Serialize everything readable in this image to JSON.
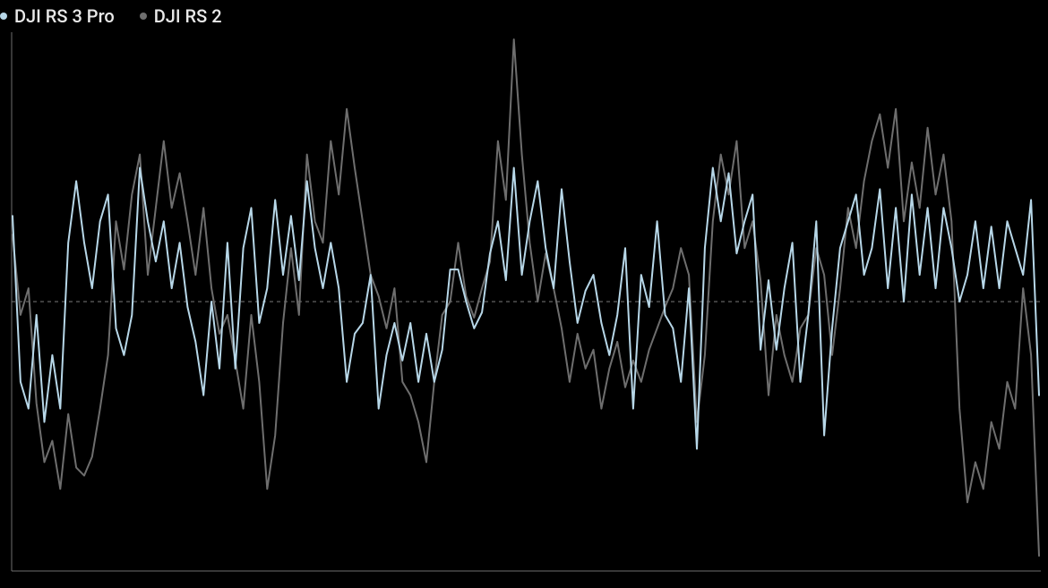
{
  "legend": {
    "items": [
      {
        "label": "DJI RS 3 Pro",
        "color": "#b7d7e8"
      },
      {
        "label": "DJI RS 2",
        "color": "#6e6e6e"
      }
    ]
  },
  "chart_data": {
    "type": "line",
    "title": "",
    "xlabel": "",
    "ylabel": "",
    "ylim": [
      -1,
      1
    ],
    "grid": false,
    "midline": 0,
    "legend_position": "top-left",
    "x": [
      0,
      1,
      2,
      3,
      4,
      5,
      6,
      7,
      8,
      9,
      10,
      11,
      12,
      13,
      14,
      15,
      16,
      17,
      18,
      19,
      20,
      21,
      22,
      23,
      24,
      25,
      26,
      27,
      28,
      29,
      30,
      31,
      32,
      33,
      34,
      35,
      36,
      37,
      38,
      39,
      40,
      41,
      42,
      43,
      44,
      45,
      46,
      47,
      48,
      49,
      50,
      51,
      52,
      53,
      54,
      55,
      56,
      57,
      58,
      59,
      60,
      61,
      62,
      63,
      64,
      65,
      66,
      67,
      68,
      69,
      70,
      71,
      72,
      73,
      74,
      75,
      76,
      77,
      78,
      79,
      80,
      81,
      82,
      83,
      84,
      85,
      86,
      87,
      88,
      89,
      90,
      91,
      92,
      93,
      94,
      95,
      96,
      97,
      98,
      99,
      100,
      101,
      102,
      103,
      104,
      105,
      106,
      107,
      108,
      109,
      110,
      111,
      112,
      113,
      114,
      115,
      116,
      117,
      118,
      119,
      120,
      121,
      122,
      123,
      124,
      125,
      126,
      127,
      128,
      129
    ],
    "series": [
      {
        "name": "DJI RS 3 Pro",
        "color": "#b7d7e8",
        "values": [
          0.32,
          -0.3,
          -0.4,
          -0.05,
          -0.45,
          -0.2,
          -0.4,
          0.22,
          0.45,
          0.22,
          0.05,
          0.3,
          0.4,
          -0.1,
          -0.2,
          -0.05,
          0.5,
          0.3,
          0.15,
          0.3,
          0.05,
          0.22,
          -0.02,
          -0.15,
          -0.35,
          0.0,
          -0.25,
          0.22,
          -0.25,
          0.2,
          0.35,
          -0.08,
          0.05,
          0.38,
          0.1,
          0.32,
          0.08,
          0.45,
          0.2,
          0.05,
          0.22,
          0.05,
          -0.3,
          -0.12,
          -0.08,
          0.1,
          -0.4,
          -0.2,
          -0.08,
          -0.22,
          -0.08,
          -0.3,
          -0.12,
          -0.3,
          -0.18,
          0.12,
          0.12,
          0.0,
          -0.1,
          -0.04,
          0.18,
          0.3,
          0.08,
          0.5,
          0.1,
          0.3,
          0.45,
          0.2,
          0.05,
          0.42,
          0.15,
          -0.08,
          0.04,
          0.1,
          -0.08,
          -0.2,
          -0.05,
          0.2,
          -0.4,
          0.1,
          -0.02,
          0.3,
          -0.05,
          -0.1,
          -0.3,
          0.05,
          -0.55,
          0.2,
          0.5,
          0.3,
          0.48,
          0.18,
          0.3,
          0.4,
          -0.18,
          0.08,
          -0.18,
          0.05,
          0.22,
          -0.3,
          -0.05,
          0.3,
          -0.5,
          -0.1,
          0.2,
          0.3,
          0.4,
          0.1,
          0.2,
          0.42,
          0.05,
          0.35,
          0.0,
          0.4,
          0.1,
          0.35,
          0.05,
          0.35,
          0.2,
          0.0,
          0.1,
          0.3,
          0.05,
          0.28,
          0.05,
          0.3,
          0.2,
          0.1,
          0.38,
          -0.35
        ]
      },
      {
        "name": "DJI RS 2",
        "color": "#6e6e6e",
        "values": [
          0.25,
          -0.05,
          0.05,
          -0.38,
          -0.6,
          -0.52,
          -0.7,
          -0.42,
          -0.62,
          -0.65,
          -0.58,
          -0.4,
          -0.2,
          0.3,
          0.12,
          0.4,
          0.55,
          0.1,
          0.35,
          0.6,
          0.35,
          0.48,
          0.3,
          0.1,
          0.35,
          0.05,
          -0.12,
          -0.05,
          -0.22,
          -0.4,
          -0.05,
          -0.3,
          -0.7,
          -0.5,
          -0.08,
          0.2,
          -0.05,
          0.55,
          0.3,
          0.22,
          0.6,
          0.4,
          0.72,
          0.5,
          0.3,
          0.1,
          0.02,
          -0.1,
          0.05,
          -0.3,
          -0.35,
          -0.45,
          -0.6,
          -0.3,
          -0.05,
          0.0,
          0.22,
          0.02,
          -0.06,
          0.05,
          0.15,
          0.6,
          0.38,
          0.98,
          0.55,
          0.22,
          0.0,
          0.18,
          0.05,
          -0.1,
          -0.3,
          -0.12,
          -0.25,
          -0.18,
          -0.4,
          -0.25,
          -0.15,
          -0.32,
          -0.22,
          -0.3,
          -0.18,
          -0.1,
          -0.02,
          0.05,
          0.2,
          0.1,
          -0.45,
          -0.2,
          0.3,
          0.55,
          0.4,
          0.6,
          0.2,
          0.3,
          0.08,
          -0.35,
          -0.05,
          -0.2,
          -0.3,
          -0.1,
          -0.05,
          0.2,
          0.1,
          -0.2,
          0.05,
          0.35,
          0.2,
          0.45,
          0.6,
          0.7,
          0.5,
          0.72,
          0.3,
          0.52,
          0.35,
          0.65,
          0.4,
          0.55,
          0.3,
          -0.4,
          -0.75,
          -0.6,
          -0.7,
          -0.45,
          -0.55,
          -0.3,
          -0.4,
          0.05,
          -0.2,
          -0.95
        ]
      }
    ]
  }
}
